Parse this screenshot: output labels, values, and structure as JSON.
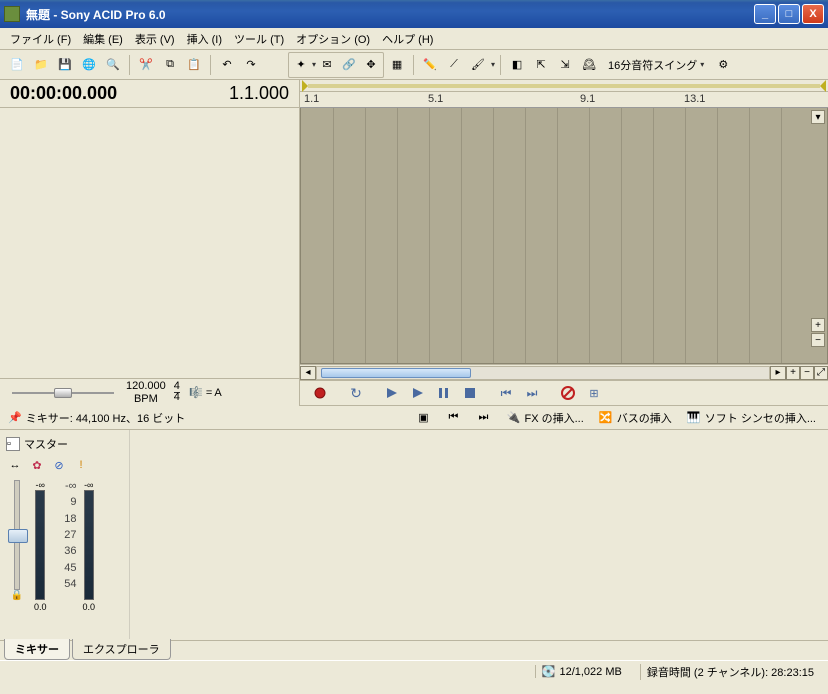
{
  "title": "無題 - Sony ACID Pro 6.0",
  "menus": {
    "file": "ファイル (F)",
    "edit": "編集 (E)",
    "view": "表示 (V)",
    "insert": "挿入 (I)",
    "tools": "ツール (T)",
    "options": "オプション (O)",
    "help": "ヘルプ (H)"
  },
  "toolbar_dropdown": "16分音符スイング",
  "time": {
    "current": "00:00:00.000",
    "position": "1.1.000"
  },
  "ruler": {
    "r1": "1.1",
    "r2": "5.1",
    "r3": "9.1",
    "r4": "13.1"
  },
  "tempo": {
    "bpm_value": "120.000",
    "bpm_label": "BPM",
    "sig_num": "4",
    "sig_den": "4",
    "key_prefix": "= ",
    "key": "A"
  },
  "mixer_info": "ミキサー: 44,100 Hz、16 ビット",
  "mixer_actions": {
    "fx_insert": "FX の挿入...",
    "bus_insert": "バスの挿入",
    "synth_insert": "ソフト シンセの挿入..."
  },
  "master": {
    "label": "マスター",
    "inf_l": "-∞",
    "inf_r": "-∞",
    "scale": [
      "-∞",
      "9",
      "18",
      "27",
      "36",
      "45",
      "54"
    ],
    "val_l": "0.0",
    "val_r": "0.0"
  },
  "tabs": {
    "mixer": "ミキサー",
    "explorer": "エクスプローラ"
  },
  "status": {
    "mem": "12/1,022 MB",
    "rec": "録音時間 (2 チャンネル): 28:23:15"
  }
}
